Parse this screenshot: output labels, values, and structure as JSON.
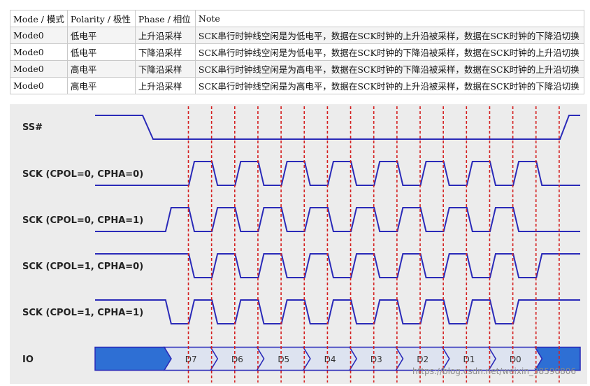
{
  "table": {
    "headers": [
      "Mode / 模式",
      "Polarity / 极性",
      "Phase / 相位",
      "Note"
    ],
    "rows": [
      [
        "Mode0",
        "低电平",
        "上升沿采样",
        "SCK串行时钟线空闲是为低电平，数据在SCK时钟的上升沿被采样，数据在SCK时钟的下降沿切换"
      ],
      [
        "Mode0",
        "低电平",
        "下降沿采样",
        "SCK串行时钟线空闲是为低电平，数据在SCK时钟的下降沿被采样，数据在SCK时钟的上升沿切换"
      ],
      [
        "Mode0",
        "高电平",
        "下降沿采样",
        "SCK串行时钟线空闲是为高电平，数据在SCK时钟的下降沿被采样，数据在SCK时钟的上升沿切换"
      ],
      [
        "Mode0",
        "高电平",
        "上升沿采样",
        "SCK串行时钟线空闲是为高电平，数据在SCK时钟的上升沿被采样，数据在SCK时钟的下降沿切换"
      ]
    ]
  },
  "diagram": {
    "signals": [
      {
        "label": "SS#",
        "type": "ss"
      },
      {
        "label": "SCK (CPOL=0, CPHA=0)",
        "type": "clock",
        "idle": "low",
        "shift": 0
      },
      {
        "label": "SCK (CPOL=0, CPHA=1)",
        "type": "clock",
        "idle": "low",
        "shift": -0.5
      },
      {
        "label": "SCK (CPOL=1, CPHA=0)",
        "type": "clock",
        "idle": "high",
        "shift": 0
      },
      {
        "label": "SCK (CPOL=1, CPHA=1)",
        "type": "clock",
        "idle": "high",
        "shift": -0.5
      },
      {
        "label": "IO",
        "type": "bus"
      }
    ],
    "bits": [
      "D7",
      "D6",
      "D5",
      "D4",
      "D3",
      "D2",
      "D1",
      "D0"
    ],
    "colors": {
      "wave": "#2a2ab8",
      "sample_line": "#d42020",
      "bus_fill": "#2e6fd4",
      "bus_bit_fill": "#dde3f0",
      "background": "#ececec"
    }
  },
  "watermarks": {
    "url": "https://blog.csdn.net/weixin_38590806"
  }
}
